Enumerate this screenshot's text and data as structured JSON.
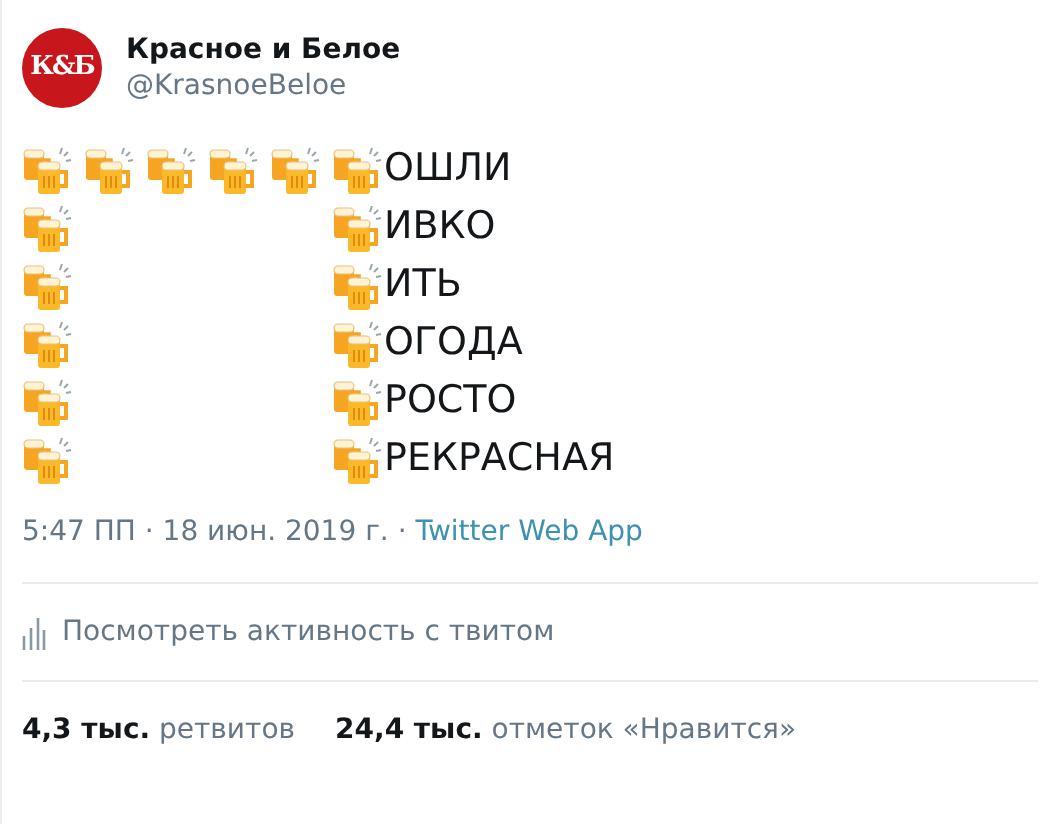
{
  "author": {
    "avatar_text": "К&Б",
    "name": "Красное и Белое",
    "handle": "@KrasnoeBeloe"
  },
  "tweet": {
    "lines": [
      {
        "kind": "top",
        "word": "ОШЛИ"
      },
      {
        "kind": "side",
        "word": "ИВКО"
      },
      {
        "kind": "side",
        "word": "ИТЬ"
      },
      {
        "kind": "side",
        "word": "ОГОДА"
      },
      {
        "kind": "side",
        "word": "РОСТО"
      },
      {
        "kind": "side",
        "word": "РЕКРАСНАЯ"
      }
    ]
  },
  "meta": {
    "time": "5:47 ПП · 18 июн. 2019 г. ·",
    "source": "Twitter Web App"
  },
  "activity_link": "Посмотреть активность с твитом",
  "stats": [
    {
      "count": "4,3 тыс.",
      "label": "ретвитов"
    },
    {
      "count": "24,4 тыс.",
      "label": "отметок «Нравится»"
    }
  ]
}
